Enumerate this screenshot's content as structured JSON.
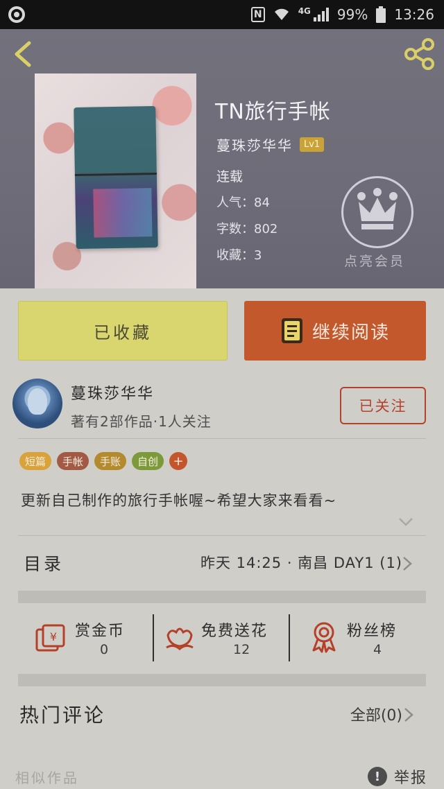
{
  "status_bar": {
    "network": "4G",
    "battery": "99%",
    "time": "13:26"
  },
  "book": {
    "title": "TN旅行手帐",
    "author": "蔓珠莎华华",
    "level": "Lv1",
    "status": "连载",
    "popularity": "人气：84",
    "word_count": "字数：802",
    "favorites": "收藏：3",
    "vip_label": "点亮会员"
  },
  "actions": {
    "collected_label": "已收藏",
    "continue_label": "继续阅读"
  },
  "author_card": {
    "name": "蔓珠莎华华",
    "meta": "著有2部作品·1人关注",
    "follow_label": "已关注"
  },
  "tags": [
    {
      "label": "短篇",
      "color": "#d9a23a"
    },
    {
      "label": "手帐",
      "color": "#a35a45"
    },
    {
      "label": "手账",
      "color": "#b48a2e"
    },
    {
      "label": "自创",
      "color": "#7d9a3b"
    }
  ],
  "tag_add": "+",
  "description": "更新自己制作的旅行手帐喔~希望大家来看看~",
  "toc": {
    "label": "目录",
    "latest": "昨天 14:25 · 南昌 DAY1 (1)"
  },
  "stats": [
    {
      "title": "赏金币",
      "value": "0",
      "icon": "reward-coin-icon"
    },
    {
      "title": "免费送花",
      "value": "12",
      "icon": "flower-icon"
    },
    {
      "title": "粉丝榜",
      "value": "4",
      "icon": "medal-icon"
    }
  ],
  "comments": {
    "title": "热门评论",
    "all_label": "全部(0)"
  },
  "footer": {
    "similar_label": "相似作品",
    "report_icon": "!",
    "report_label": "举报"
  },
  "colors": {
    "accent_orange": "#c4582d",
    "collected_yellow": "#d9d56f",
    "follow_red": "#b5412c",
    "level_gold": "#c9a33a"
  }
}
